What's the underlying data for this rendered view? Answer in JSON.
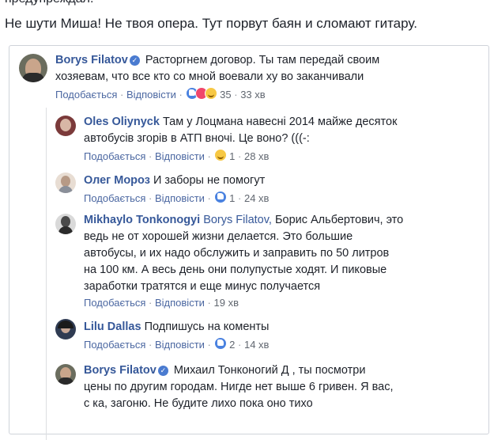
{
  "post": {
    "top_cut_text": "предупреждал.",
    "caption": "Не шути Миша! Не твоя опера. Тут порвут баян и сломают гитару."
  },
  "labels": {
    "like": "Подобається",
    "reply": "Відповісти",
    "sep": "·"
  },
  "comments": [
    {
      "author": "Borys Filatov",
      "verified": true,
      "lines": [
        "Расторгнем договор. Ты там передай своим",
        "хозяевам, что все кто со мной воевали ху  во заканчивали"
      ],
      "reactions": [
        "r-like",
        "r-love",
        "r-haha"
      ],
      "count": "35",
      "time": "33 хв",
      "avatar_color": "#6b6d5e"
    },
    {
      "author": "Oles Oliynyck",
      "lines": [
        "Там у Лоцмана навесні 2014 майже десяток",
        "автобусів згорів в АТП вночі. Це воно? (((-:"
      ],
      "reactions": [
        "r-haha"
      ],
      "count": "1",
      "time": "28 хв",
      "avatar_color": "#7b3a3a"
    },
    {
      "author": "Олег Мороз",
      "lines": [
        "И заборы не помогут"
      ],
      "reactions": [
        "r-like"
      ],
      "count": "1",
      "time": "24 хв",
      "avatar_color": "#b79a86"
    },
    {
      "author": "Mikhaylo Tonkonogyi",
      "mention": "Borys Filatov,",
      "lines": [
        "Борис Альбертович, это",
        "ведь не от хорошей жизни делается. Это большие",
        "автобусы, и их надо обслужить и заправить по 50 литров",
        "на 100 км. А весь день они полупустые ходят. И пиковые",
        "заработки тратятся и еще минус получается"
      ],
      "reactions": [],
      "count": "",
      "time": "19 хв",
      "avatar_color": "#4a4a4a"
    },
    {
      "author": "Lilu Dallas",
      "lines": [
        "Подпишусь на коменты"
      ],
      "reactions": [
        "r-like"
      ],
      "count": "2",
      "time": "14 хв",
      "avatar_color": "#2f3b52"
    },
    {
      "author": "Borys Filatov",
      "verified": true,
      "lines": [
        "Михаил Тонконогий Д       , ты посмотри",
        "цены по другим городам. Нигде нет выше 6 гривен. Я вас,",
        "с   ка, загоню. Не будите лихо пока оно тихо"
      ],
      "reactions": [],
      "count": "",
      "time": "",
      "avatar_color": "#6b6d5e"
    }
  ]
}
